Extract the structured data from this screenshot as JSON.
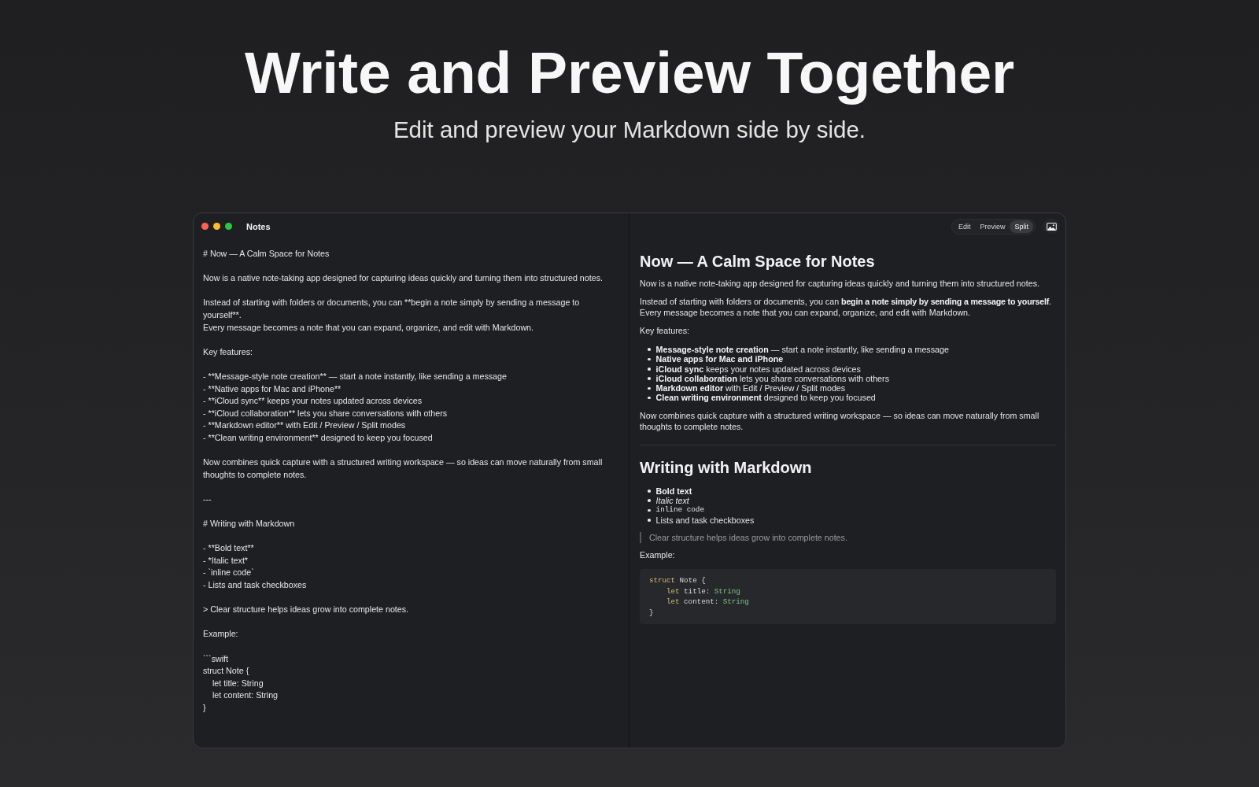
{
  "hero": {
    "title": "Write and Preview Together",
    "subtitle": "Edit and preview your Markdown side by side."
  },
  "window": {
    "title": "Notes"
  },
  "toolbar": {
    "modes": [
      {
        "label": "Edit",
        "selected": false
      },
      {
        "label": "Preview",
        "selected": false
      },
      {
        "label": "Split",
        "selected": true
      }
    ]
  },
  "editor": {
    "blocks": [
      {
        "lines": [
          "# Now — A Calm Space for Notes"
        ]
      },
      {
        "lines": [
          "Now is a native note-taking app designed for capturing ideas quickly and turning them into structured notes."
        ]
      },
      {
        "lines": [
          "Instead of starting with folders or documents, you can **begin a note simply by sending a message to yourself**.",
          "Every message becomes a note that you can expand, organize, and edit with Markdown."
        ]
      },
      {
        "lines": [
          "Key features:"
        ]
      },
      {
        "lines": [
          "- **Message-style note creation** — start a note instantly, like sending a message",
          "- **Native apps for Mac and iPhone**",
          "- **iCloud sync** keeps your notes updated across devices",
          "- **iCloud collaboration** lets you share conversations with others",
          "- **Markdown editor** with Edit / Preview / Split modes",
          "- **Clean writing environment** designed to keep you focused"
        ]
      },
      {
        "lines": [
          "Now combines quick capture with a structured writing workspace — so ideas can move naturally from small thoughts to complete notes."
        ]
      },
      {
        "lines": [
          "---"
        ]
      },
      {
        "lines": [
          "# Writing with Markdown"
        ]
      },
      {
        "lines": [
          "- **Bold text**",
          "- *Italic text*",
          "- `inline code`",
          "- Lists and task checkboxes"
        ]
      },
      {
        "lines": [
          "> Clear structure helps ideas grow into complete notes."
        ]
      },
      {
        "lines": [
          "Example:"
        ]
      },
      {
        "lines": [
          "```swift",
          "struct Note {",
          "    let title: String",
          "    let content: String",
          "}"
        ]
      }
    ]
  },
  "preview": {
    "blocks": [
      {
        "kind": "heading",
        "text": "Now — A Calm Space for Notes"
      },
      {
        "kind": "paragraph",
        "text": "Now is a native note-taking app designed for capturing ideas quickly and turning them into structured notes."
      },
      {
        "kind": "paragraph",
        "text": "Instead of starting with folders or documents, you can **begin a note simply by sending a message to yourself**.\nEvery message becomes a note that you can expand, organize, and edit with Markdown."
      },
      {
        "kind": "paragraph",
        "text": "Key features:"
      },
      {
        "kind": "list",
        "items": [
          {
            "text": "**Message-style note creation** — start a note instantly, like sending a message"
          },
          {
            "text": "**Native apps for Mac and iPhone**"
          },
          {
            "text": "**iCloud sync** keeps your notes updated across devices"
          },
          {
            "text": "**iCloud collaboration** lets you share conversations with others"
          },
          {
            "text": "**Markdown editor** with Edit / Preview / Split modes"
          },
          {
            "text": "**Clean writing environment** designed to keep you focused"
          }
        ]
      },
      {
        "kind": "paragraph",
        "text": "Now combines quick capture with a structured writing workspace — so ideas can move naturally from small thoughts to complete notes."
      },
      {
        "kind": "rule"
      },
      {
        "kind": "heading",
        "text": "Writing with Markdown"
      },
      {
        "kind": "list",
        "items": [
          {
            "text": "**Bold text**",
            "kind": "text"
          },
          {
            "text": "*Italic text*",
            "kind": "text"
          },
          {
            "text": "inline code",
            "kind": "code"
          },
          {
            "text": "Lists and task checkboxes",
            "kind": "text"
          }
        ]
      },
      {
        "kind": "quote",
        "text": "Clear structure helps ideas grow into complete notes."
      },
      {
        "kind": "paragraph",
        "text": "Example:"
      },
      {
        "kind": "code",
        "lines": [
          {
            "tokens": [
              {
                "kind": "keyword",
                "text": "struct"
              },
              {
                "kind": "plain",
                "text": "Note {"
              }
            ],
            "children": [
              {
                "tokens": [
                  {
                    "kind": "keyword",
                    "text": "let"
                  },
                  {
                    "kind": "plain",
                    "text": "title:"
                  },
                  {
                    "kind": "type",
                    "text": "String"
                  }
                ]
              },
              {
                "tokens": [
                  {
                    "kind": "keyword",
                    "text": "let"
                  },
                  {
                    "kind": "plain",
                    "text": "content:"
                  },
                  {
                    "kind": "type",
                    "text": "String"
                  }
                ]
              }
            ]
          },
          {
            "tokens": [
              {
                "kind": "plain",
                "text": "}"
              }
            ]
          }
        ]
      }
    ]
  }
}
